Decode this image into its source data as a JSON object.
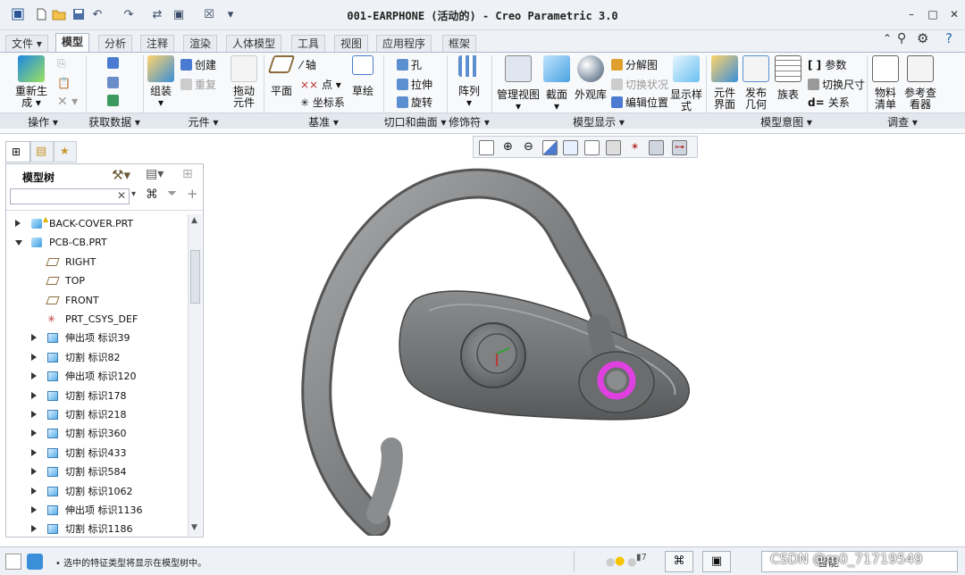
{
  "title": "001-EARPHONE (活动的) - Creo Parametric 3.0",
  "tabs": [
    "文件",
    "模型",
    "分析",
    "注释",
    "渲染",
    "人体模型",
    "工具",
    "视图",
    "应用程序",
    "框架"
  ],
  "groups": {
    "operations": "操作",
    "get_data": "获取数据",
    "components": "元件",
    "datum": "基准",
    "cut_surface": "切口和曲面",
    "modifiers": "修饰符",
    "model_display": "模型显示",
    "model_intent": "模型意图",
    "investigate": "调查"
  },
  "buttons": {
    "regenerate": "重新生成",
    "assemble": "组装",
    "create": "创建",
    "repeat": "重复",
    "drag_components": "拖动元件",
    "plane": "平面",
    "axis": "轴",
    "point": "点",
    "csys": "坐标系",
    "sketch": "草绘",
    "hole": "孔",
    "extrude": "拉伸",
    "revolve": "旋转",
    "pattern": "阵列",
    "manage_views": "管理视图",
    "section": "截面",
    "appearance": "外观库",
    "exploded_view": "分解图",
    "toggle_status": "切换状况",
    "edit_position": "编辑位置",
    "display_style": "显示样式",
    "component_interface": "元件界面",
    "publish_geometry": "发布几何",
    "family_table": "族表",
    "parameters": "参数",
    "switch_dimensions": "切换尺寸",
    "relations": "关系",
    "bill_of_materials": "物料清单",
    "reference_viewer": "参考查看器"
  },
  "model_tree": {
    "title": "模型树",
    "items": [
      {
        "label": "BACK-COVER.PRT",
        "kind": "part",
        "expand": "collapsed",
        "warning": true
      },
      {
        "label": "PCB-CB.PRT",
        "kind": "part",
        "expand": "expanded",
        "warning": false
      },
      {
        "label": "RIGHT",
        "kind": "datum-plane",
        "expand": "none"
      },
      {
        "label": "TOP",
        "kind": "datum-plane",
        "expand": "none"
      },
      {
        "label": "FRONT",
        "kind": "datum-plane",
        "expand": "none"
      },
      {
        "label": "PRT_CSYS_DEF",
        "kind": "csys",
        "expand": "none"
      },
      {
        "label": "伸出项 标识39",
        "kind": "feature",
        "expand": "collapsed"
      },
      {
        "label": "切割 标识82",
        "kind": "feature",
        "expand": "collapsed"
      },
      {
        "label": "伸出项 标识120",
        "kind": "feature",
        "expand": "collapsed"
      },
      {
        "label": "切割 标识178",
        "kind": "feature",
        "expand": "collapsed"
      },
      {
        "label": "切割 标识218",
        "kind": "feature",
        "expand": "collapsed"
      },
      {
        "label": "切割 标识360",
        "kind": "feature",
        "expand": "collapsed"
      },
      {
        "label": "切割 标识433",
        "kind": "feature",
        "expand": "collapsed"
      },
      {
        "label": "切割 标识584",
        "kind": "feature",
        "expand": "collapsed"
      },
      {
        "label": "切割 标识1062",
        "kind": "feature",
        "expand": "collapsed"
      },
      {
        "label": "伸出项 标识1136",
        "kind": "feature",
        "expand": "collapsed"
      },
      {
        "label": "切割 标识1186",
        "kind": "feature",
        "expand": "collapsed"
      }
    ]
  },
  "status": {
    "message": "• 选中的特征类型将显示在模型树中。",
    "watermark": "CSDN @m0_71719549",
    "filter_prefix": "智能"
  },
  "colors": {
    "accent": "#2b6cb0",
    "highlight_ring": "#e040e0",
    "model_gray": "#8a8c8e"
  }
}
